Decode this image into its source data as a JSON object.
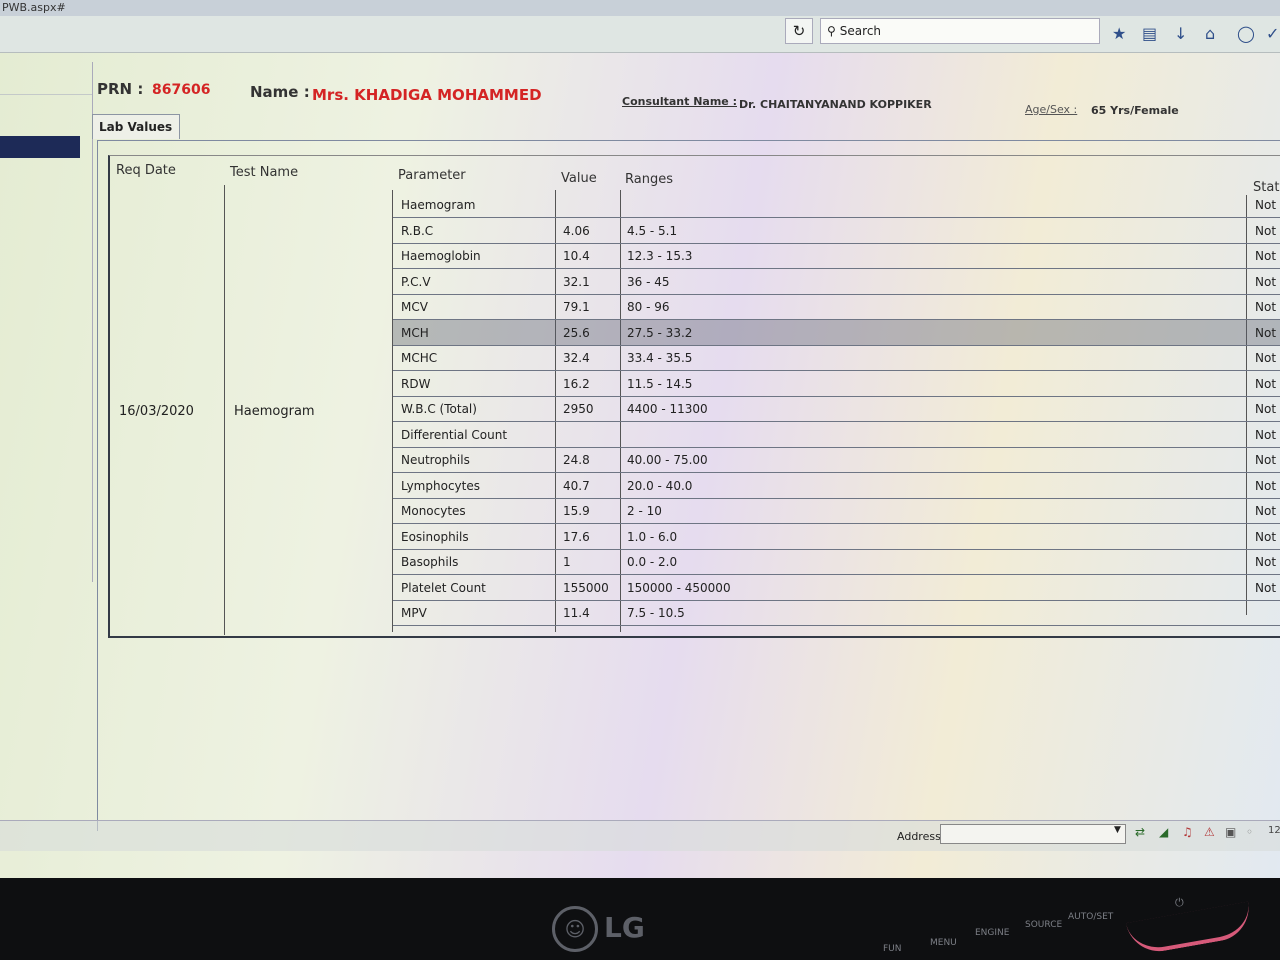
{
  "window": {
    "title": "PWB.aspx#"
  },
  "toolbar": {
    "search_placeholder": "Search"
  },
  "header": {
    "prn_label": "PRN :",
    "prn_value": "867606",
    "name_label": "Name :",
    "name_value": "Mrs. KHADIGA MOHAMMED",
    "consultant_label": "Consultant Name :",
    "consultant_value": "Dr. CHAITANYANAND KOPPIKER",
    "age_label": "Age/Sex :",
    "age_value": "65 Yrs/Female"
  },
  "tab": {
    "label": "Lab Values"
  },
  "grid": {
    "headers": {
      "req_date": "Req Date",
      "test_name": "Test Name",
      "parameter": "Parameter",
      "value": "Value",
      "ranges": "Ranges",
      "status": "Statu"
    },
    "req_date": "16/03/2020",
    "test_name": "Haemogram",
    "rows": [
      {
        "parameter": "Haemogram",
        "value": "",
        "range": "",
        "status": "Not"
      },
      {
        "parameter": "R.B.C",
        "value": "4.06",
        "range": "4.5 - 5.1",
        "status": "Not"
      },
      {
        "parameter": "Haemoglobin",
        "value": "10.4",
        "range": "12.3 - 15.3",
        "status": "Not"
      },
      {
        "parameter": "P.C.V",
        "value": "32.1",
        "range": "36 - 45",
        "status": "Not"
      },
      {
        "parameter": "MCV",
        "value": "79.1",
        "range": "80 - 96",
        "status": "Not"
      },
      {
        "parameter": "MCH",
        "value": "25.6",
        "range": "27.5 - 33.2",
        "status": "Not"
      },
      {
        "parameter": "MCHC",
        "value": "32.4",
        "range": "33.4 - 35.5",
        "status": "Not"
      },
      {
        "parameter": "RDW",
        "value": "16.2",
        "range": "11.5 - 14.5",
        "status": "Not"
      },
      {
        "parameter": "W.B.C (Total)",
        "value": "2950",
        "range": "4400 - 11300",
        "status": "Not"
      },
      {
        "parameter": "Differential Count",
        "value": "",
        "range": "",
        "status": "Not"
      },
      {
        "parameter": "Neutrophils",
        "value": "24.8",
        "range": "40.00 - 75.00",
        "status": "Not"
      },
      {
        "parameter": "Lymphocytes",
        "value": "40.7",
        "range": "20.0 - 40.0",
        "status": "Not"
      },
      {
        "parameter": "Monocytes",
        "value": "15.9",
        "range": "2 - 10",
        "status": "Not"
      },
      {
        "parameter": "Eosinophils",
        "value": "17.6",
        "range": "1.0 - 6.0",
        "status": "Not"
      },
      {
        "parameter": "Basophils",
        "value": "1",
        "range": "0.0 - 2.0",
        "status": "Not"
      },
      {
        "parameter": "Platelet Count",
        "value": "155000",
        "range": "150000 - 450000",
        "status": "Not"
      },
      {
        "parameter": "MPV",
        "value": "11.4",
        "range": "7.5 - 10.5",
        "status": ""
      }
    ]
  },
  "bottom": {
    "address_label": "Address",
    "tray_number": "12"
  },
  "monitor": {
    "brand": "LG",
    "buttons": [
      "FUN",
      "MENU",
      "ENGINE",
      "SOURCE",
      "AUTO/SET"
    ]
  },
  "colors": {
    "accent_red": "#d42424",
    "selection": "#5a5f6e",
    "brand_pink": "#d65a7a"
  }
}
